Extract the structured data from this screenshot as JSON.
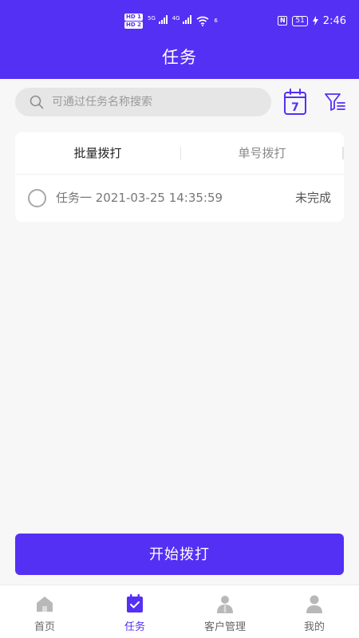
{
  "status_bar": {
    "hd1": "HD 1",
    "hd2": "HD 2",
    "net1": "5G",
    "net2": "4G",
    "wifi_tag": "6",
    "battery": "51",
    "time": "2:46"
  },
  "header": {
    "title": "任务"
  },
  "search": {
    "placeholder": "可通过任务名称搜索",
    "value": ""
  },
  "calendar": {
    "day": "7"
  },
  "tabs": [
    {
      "label": "批量拨打",
      "active": true
    },
    {
      "label": "单号拨打",
      "active": false
    }
  ],
  "tasks": [
    {
      "name": "任务一 2021-03-25 14:35:59",
      "status": "未完成",
      "checked": false
    }
  ],
  "start_button": {
    "label": "开始拨打"
  },
  "bottom_nav": [
    {
      "label": "首页",
      "icon": "home-icon",
      "active": false
    },
    {
      "label": "任务",
      "icon": "task-icon",
      "active": true
    },
    {
      "label": "客户管理",
      "icon": "customer-icon",
      "active": false
    },
    {
      "label": "我的",
      "icon": "profile-icon",
      "active": false
    }
  ],
  "colors": {
    "primary": "#5430f5",
    "background": "#f7f7f7",
    "nav_inactive": "#b8b8b8"
  }
}
